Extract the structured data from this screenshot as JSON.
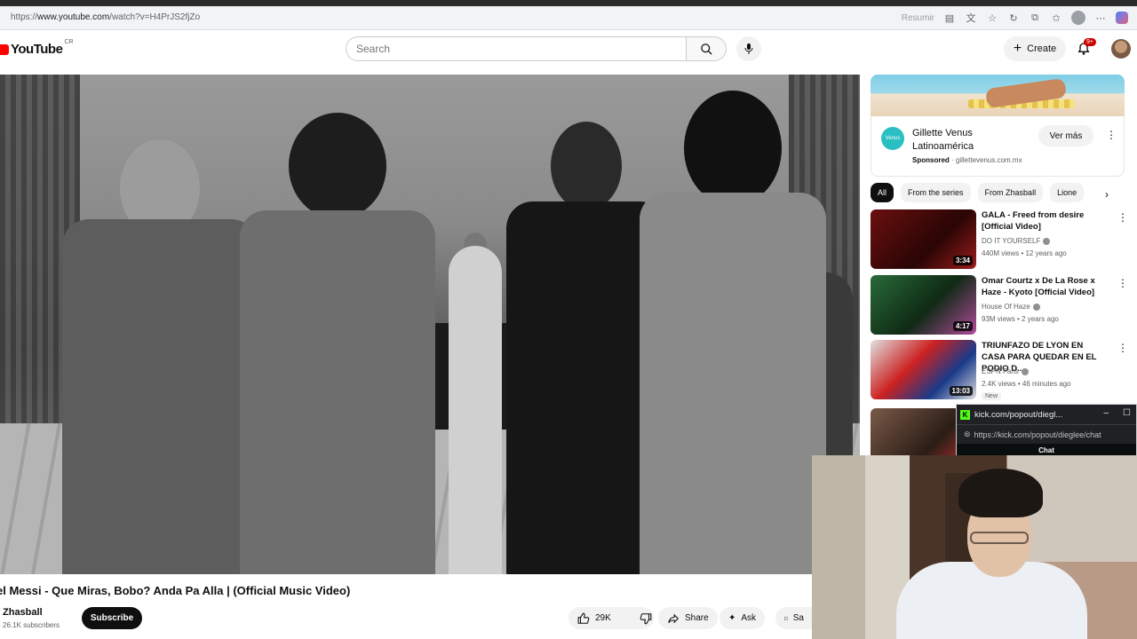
{
  "browser": {
    "url_prefix": "https://",
    "url_host": "www.youtube.com",
    "url_path": "/watch?v=H4PrJS2fjZo",
    "resumir": "Resumir"
  },
  "header": {
    "logo_text": "YouTube",
    "country_code": "CR",
    "search_placeholder": "Search",
    "create_label": "Create",
    "notification_count": "9+"
  },
  "video": {
    "title": "el Messi - Que Miras, Bobo? Anda Pa Alla | (Official Music Video)",
    "channel": "Zhasball",
    "subscribers": "26.1K subscribers",
    "subscribe_label": "Subscribe",
    "likes": "29K",
    "share_label": "Share",
    "ask_label": "Ask",
    "save_label": "Sa"
  },
  "ad": {
    "title": "Gillette Venus Latinoamérica",
    "sponsored": "Sponsored",
    "domain": "gillettevenus.com.mx",
    "cta": "Ver más",
    "logo_text": "Venus"
  },
  "chips": [
    "All",
    "From the series",
    "From Zhasball",
    "Lione"
  ],
  "recommendations": [
    {
      "title": "GALA - Freed from desire [Official Video]",
      "channel": "DO IT YOURSELF",
      "meta": "440M views • 12 years ago",
      "duration": "3:34"
    },
    {
      "title": "Omar Courtz x De La Rose x Haze - Kyoto [Official Video]",
      "channel": "House Of Haze",
      "meta": "93M views • 2 years ago",
      "duration": "4:17"
    },
    {
      "title": "TRIUNFAZO DE LYON EN CASA PARA QUEDAR EN EL PODIO D...",
      "channel": "ESPN Fans",
      "meta": "2.4K views • 46 minutes ago",
      "duration": "13:03",
      "badge": "New"
    }
  ],
  "kick": {
    "window_title": "kick.com/popout/diegl...",
    "url": "https://kick.com/popout/dieglee/chat",
    "chat_label": "Chat"
  }
}
